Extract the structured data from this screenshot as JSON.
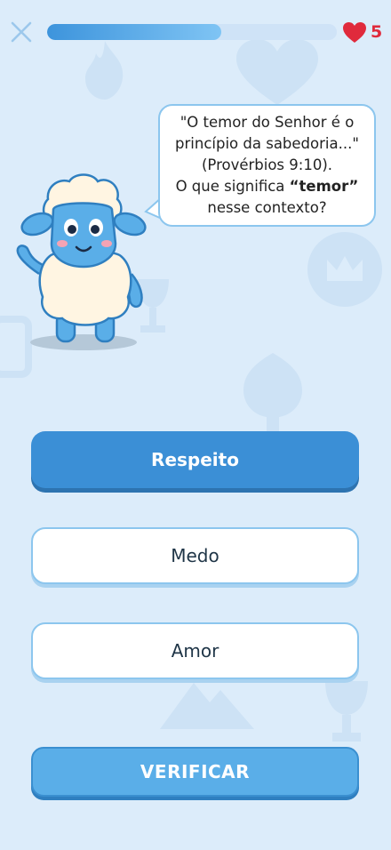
{
  "header": {
    "close_icon": "close-icon",
    "progress_fraction": 0.6,
    "lives": "5",
    "heart_icon": "heart-icon"
  },
  "question": {
    "line1": "\"O temor do Senhor é o",
    "line2": "princípio da sabedoria...\"",
    "line3": "(Provérbios 9:10).",
    "line4_prefix": "O que significa ",
    "line4_highlight": "“temor”",
    "line5": "nesse contexto?"
  },
  "options": [
    {
      "label": "Respeito",
      "selected": true
    },
    {
      "label": "Medo",
      "selected": false
    },
    {
      "label": "Amor",
      "selected": false
    }
  ],
  "verify_label": "VERIFICAR",
  "colors": {
    "background": "#dcecfa",
    "accent": "#3b8fd6",
    "heart": "#e02a3c",
    "border": "#8cc6ee"
  }
}
